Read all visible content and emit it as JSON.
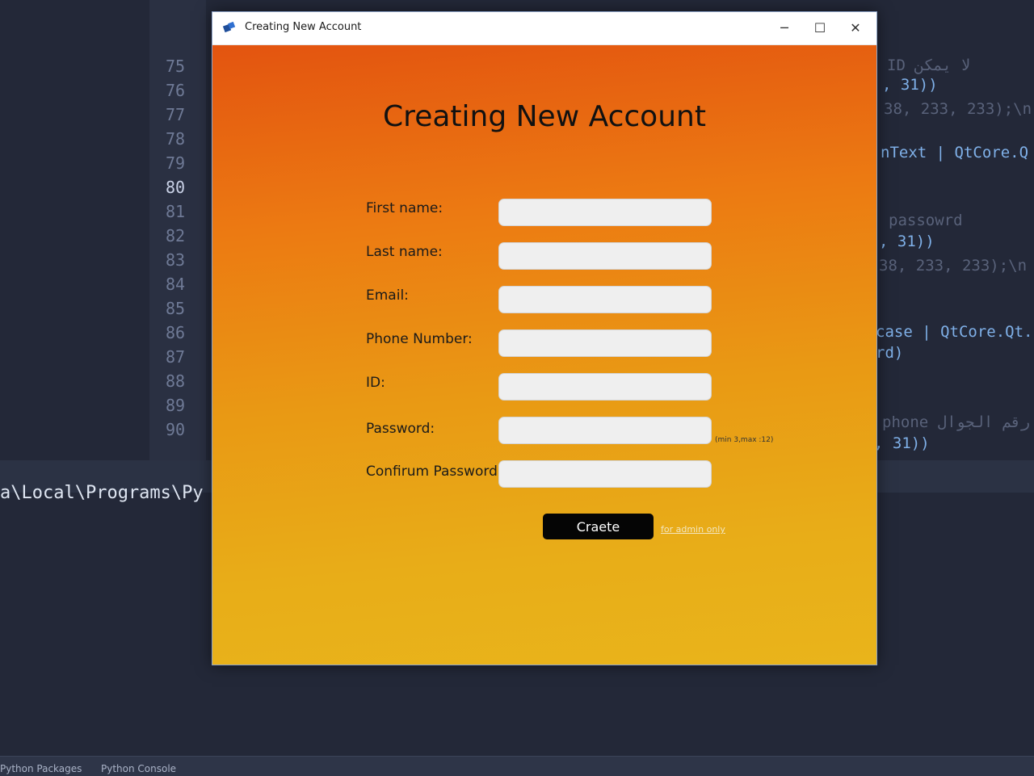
{
  "window": {
    "title": "Creating New Account",
    "controls": {
      "minimize": "─",
      "maximize": "☐",
      "close": "✕"
    }
  },
  "form": {
    "heading": "Creating New Account",
    "fields": [
      {
        "label": "First name:",
        "value": ""
      },
      {
        "label": "Last name:",
        "value": ""
      },
      {
        "label": "Email:",
        "value": ""
      },
      {
        "label": "Phone Number:",
        "value": ""
      },
      {
        "label": "ID:",
        "value": ""
      },
      {
        "label": "Password:",
        "value": ""
      },
      {
        "label": "Confirum Password:",
        "value": ""
      }
    ],
    "password_hint": "(min 3,max :12)",
    "create_button": "Craete",
    "admin_link": "for admin only"
  },
  "ide": {
    "line_numbers": [
      "75",
      "76",
      "77",
      "78",
      "79",
      "80",
      "81",
      "82",
      "83",
      "84",
      "85",
      "86",
      "87",
      "88",
      "89",
      "90"
    ],
    "active_line": "80",
    "code_fragments": [
      "ID  لا يمكن ",
      ", 31))",
      "38, 233, 233);\\n",
      "nText | QtCore.Q",
      "passowrd",
      ", 31))",
      "38, 233, 233);\\n",
      "case | QtCore.Qt.",
      "rd)",
      "phone  رقم الجوال",
      ", 31))"
    ],
    "terminal_path": "a\\Local\\Programs\\Py",
    "bottom_tabs": [
      "Python Packages",
      "Python Console"
    ]
  },
  "colors": {
    "gradient_top": "#e35410",
    "gradient_bottom": "#e9b41b",
    "button": "#050505",
    "field": "#efefef"
  }
}
